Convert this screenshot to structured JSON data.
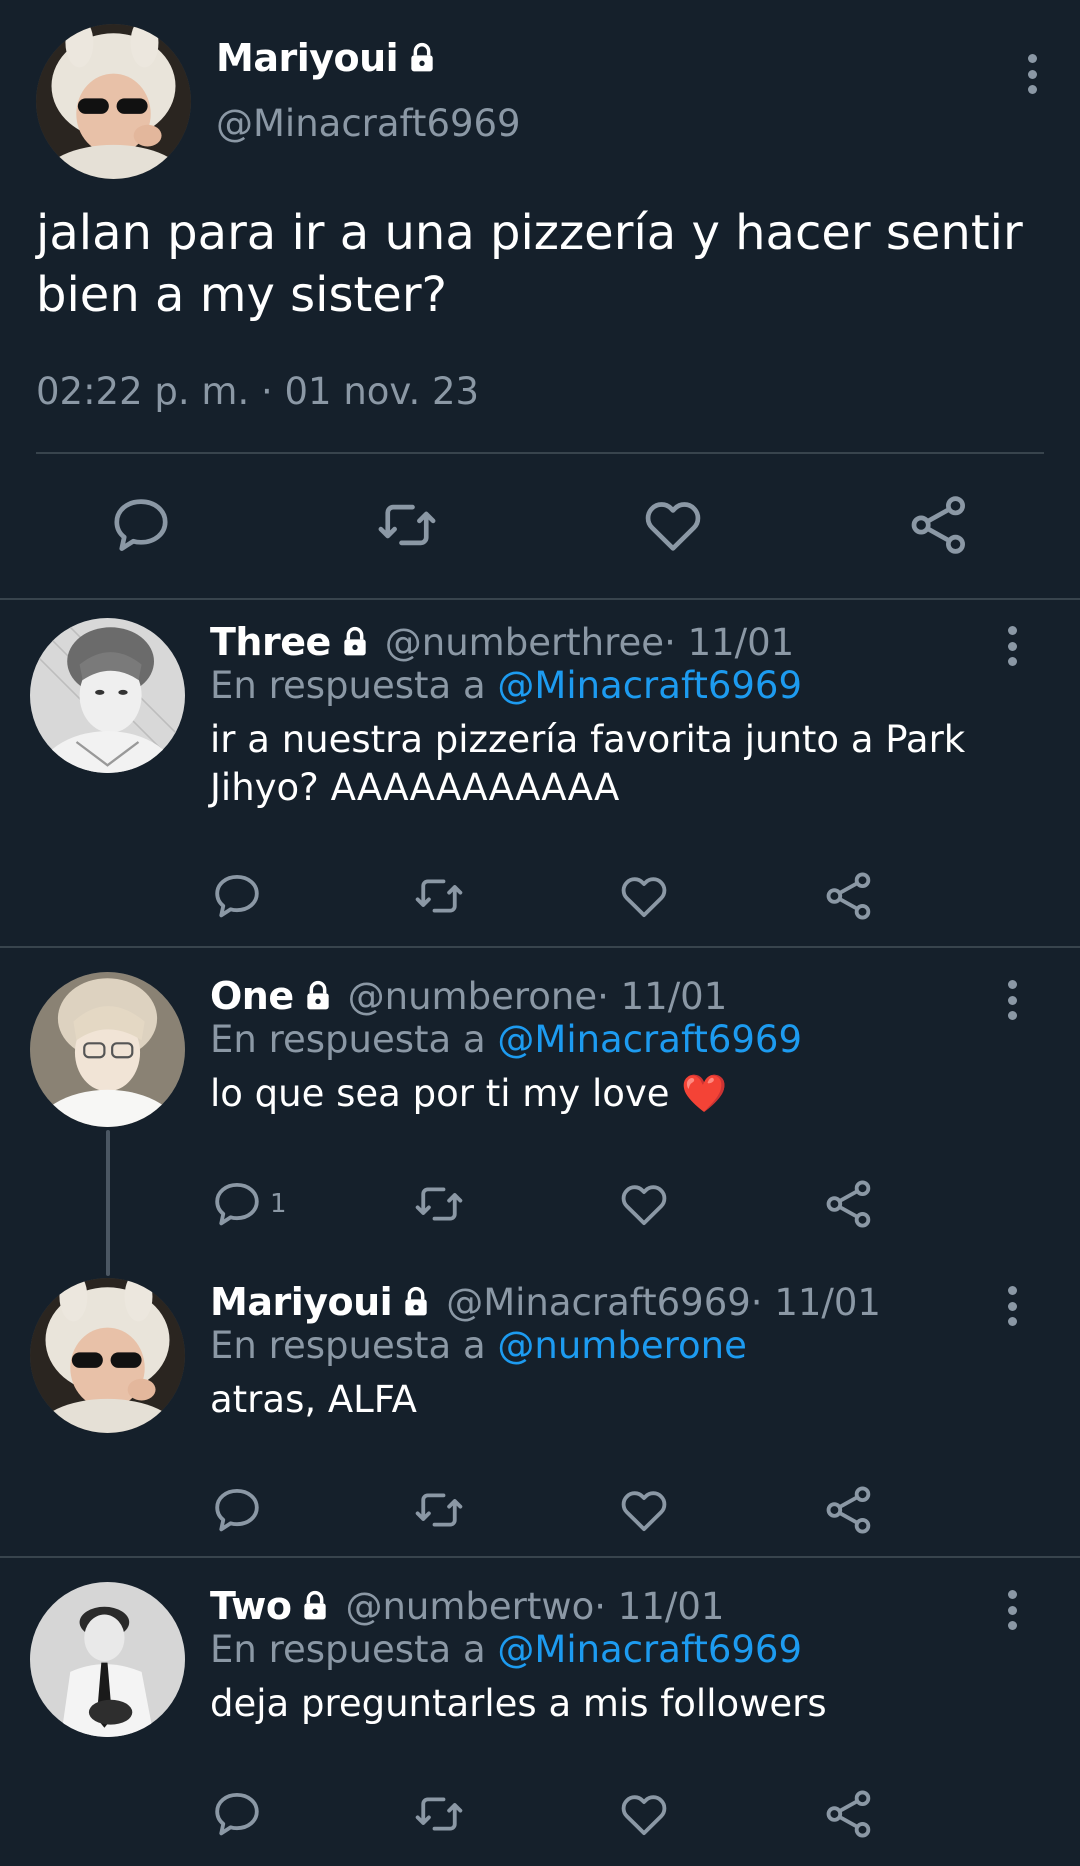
{
  "main_tweet": {
    "name": "Mariyoui",
    "handle": "@Minacraft6969",
    "text": "jalan para ir a una pizzería y hacer sentir bien a my sister?",
    "timestamp": "02:22 p. m. · 01 nov. 23"
  },
  "replies": [
    {
      "name": "Three",
      "handle": "@numberthree",
      "date": " · 11/01",
      "in_reply_prefix": "En respuesta a ",
      "in_reply_to": "@Minacraft6969",
      "text": "ir a nuestra pizzería favorita junto a Park Jihyo? AAAAAAAAAAA",
      "reply_count": ""
    },
    {
      "name": "One",
      "handle": "@numberone",
      "date": " · 11/01",
      "in_reply_prefix": "En respuesta a ",
      "in_reply_to": "@Minacraft6969",
      "text": "lo que sea por ti my love ❤️",
      "reply_count": "1"
    },
    {
      "name": "Mariyoui",
      "handle": "@Minacraft6969",
      "date": " · 11/01",
      "in_reply_prefix": "En respuesta a ",
      "in_reply_to": "@numberone",
      "text": "atras, ALFA",
      "reply_count": ""
    },
    {
      "name": "Two",
      "handle": "@numbertwo",
      "date": " · 11/01",
      "in_reply_prefix": "En respuesta a ",
      "in_reply_to": "@Minacraft6969",
      "text": "deja preguntarles a mis followers",
      "reply_count": ""
    }
  ],
  "icons": {
    "reply": "reply-icon",
    "retweet": "retweet-icon",
    "like": "like-icon",
    "share": "share-icon",
    "lock": "lock-icon",
    "menu": "more-options-icon"
  },
  "colors": {
    "background": "#15202b",
    "text": "#ffffff",
    "secondary": "#8b98a5",
    "link": "#1d9bf0",
    "divider": "#38444d"
  }
}
